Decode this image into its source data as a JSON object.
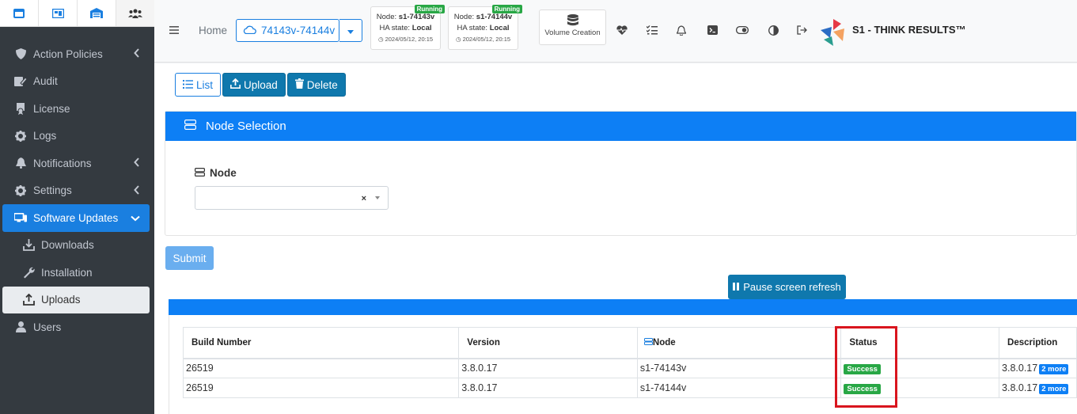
{
  "sidebar": {
    "items": [
      {
        "label": "Action Policies"
      },
      {
        "label": "Audit"
      },
      {
        "label": "License"
      },
      {
        "label": "Logs"
      },
      {
        "label": "Notifications"
      },
      {
        "label": "Settings"
      },
      {
        "label": "Software Updates"
      },
      {
        "label": "Downloads"
      },
      {
        "label": "Installation"
      },
      {
        "label": "Uploads"
      },
      {
        "label": "Users"
      }
    ]
  },
  "header": {
    "home": "Home",
    "cluster": "74143v-74144v",
    "nodes": [
      {
        "node_prefix": "Node:",
        "node": "s1-74143v",
        "ha_prefix": "HA state:",
        "ha": "Local",
        "time": "2024/05/12, 20:15",
        "badge": "Running"
      },
      {
        "node_prefix": "Node:",
        "node": "s1-74144v",
        "ha_prefix": "HA state:",
        "ha": "Local",
        "time": "2024/05/12, 20:15",
        "badge": "Running"
      }
    ],
    "volume_creation": "Volume Creation",
    "brand": "S1 - THINK RESULTS™"
  },
  "toolbar": {
    "list": "List",
    "upload": "Upload",
    "delete": "Delete"
  },
  "node_selection": {
    "title": "Node Selection",
    "label": "Node",
    "clear": "×"
  },
  "submit": "Submit",
  "pause": "Pause screen refresh",
  "table": {
    "headers": [
      "Build Number",
      "Version",
      "Node",
      "Status",
      "Description"
    ],
    "rows": [
      {
        "build": "26519",
        "version": "3.8.0.17",
        "node": "s1-74143v",
        "status": "Success",
        "desc": "3.8.0.17",
        "more": "2 more"
      },
      {
        "build": "26519",
        "version": "3.8.0.17",
        "node": "s1-74144v",
        "status": "Success",
        "desc": "3.8.0.17",
        "more": "2 more"
      }
    ]
  },
  "colors": {
    "primary": "#0d7ff5",
    "sidebar": "#343a40",
    "success": "#28a745",
    "highlight": "#d9151e"
  }
}
